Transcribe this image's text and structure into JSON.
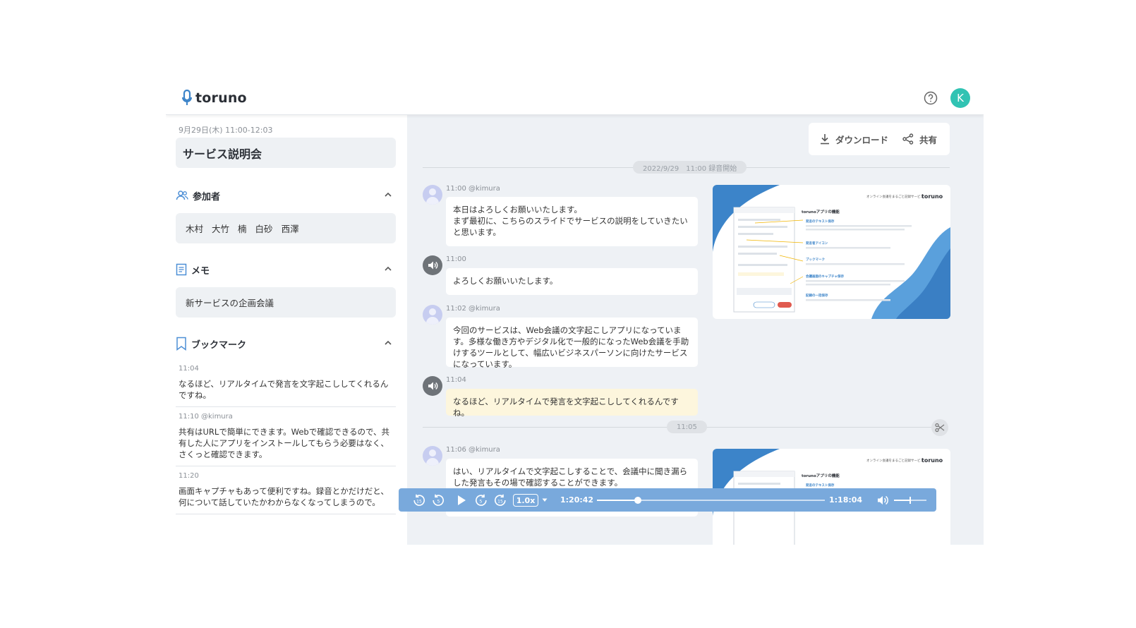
{
  "header": {
    "logo_text": "toruno",
    "help_icon": "help-circle-icon",
    "user_avatar_letter": "K",
    "accent_color": "#31c3b3"
  },
  "sidebar": {
    "meeting_datetime": "9月29日(木) 11:00-12:03",
    "meeting_title": "サービス説明会",
    "participants": {
      "label": "参加者",
      "names": [
        "木村",
        "大竹",
        "楠",
        "白砂",
        "西澤"
      ]
    },
    "memo": {
      "label": "メモ",
      "text": "新サービスの企画会議"
    },
    "bookmarks": {
      "label": "ブックマーク",
      "items": [
        {
          "time": "11:04",
          "text": "なるほど、リアルタイムで発言を文字起こししてくれるんですね。"
        },
        {
          "time": "11:10 @kimura",
          "text": "共有はURLで簡単にできます。Webで確認できるので、共有した人にアプリをインストールしてもらう必要はなく、さくっと確認できます。"
        },
        {
          "time": "11:20",
          "text": "画面キャプチャもあって便利ですね。録音とかだけだと、何について話していたかわからなくなってしまうので。"
        }
      ]
    }
  },
  "actions": {
    "download_label": "ダウンロード",
    "share_label": "共有"
  },
  "transcript": {
    "record_start_label": "2022/9/29　11:00 録音開始",
    "time_divider_label": "11:05",
    "messages": [
      {
        "meta": "11:00 @kimura",
        "avatar": "user-avatar-icon",
        "text": "本日はよろしくお願いいたします。\nまず最初に、こちらのスライドでサービスの説明をしていきたいと思います。"
      },
      {
        "meta": "11:00",
        "avatar": "speaker-icon",
        "text": "よろしくお願いいたします。"
      },
      {
        "meta": "11:02 @kimura",
        "avatar": "user-avatar-icon",
        "text": "今回のサービスは、Web会議の文字起こしアプリになっています。多様な働き方やデジタル化で一般的になったWeb会議を手助けするツールとして、幅広いビジネスパーソンに向けたサービスになっています。"
      },
      {
        "meta": "11:04",
        "avatar": "speaker-icon",
        "text": "なるほど、リアルタイムで発言を文字起こししてくれるんですね。",
        "highlighted": true
      },
      {
        "meta": "11:06 @kimura",
        "avatar": "user-avatar-icon",
        "text": "はい、リアルタイムで文字起こしすることで、会議中に聞き漏らした発言もその場で確認することができます。"
      }
    ],
    "slide": {
      "header_text": "オンライン会議をまるごと記録サービス",
      "brand": "toruno",
      "title": "torunoアプリの機能",
      "features": [
        "発言のテキスト保存",
        "発言者アイコン",
        "ブックマーク",
        "会議画面のキャプチャ保存",
        "記録の一括保存"
      ]
    }
  },
  "player": {
    "speed_label": "1.0x",
    "current_time": "1:20:42",
    "remaining_time": "1:18:04",
    "progress_fraction": 0.18,
    "volume_fraction": 0.5,
    "bar_color": "#79a9dc"
  }
}
